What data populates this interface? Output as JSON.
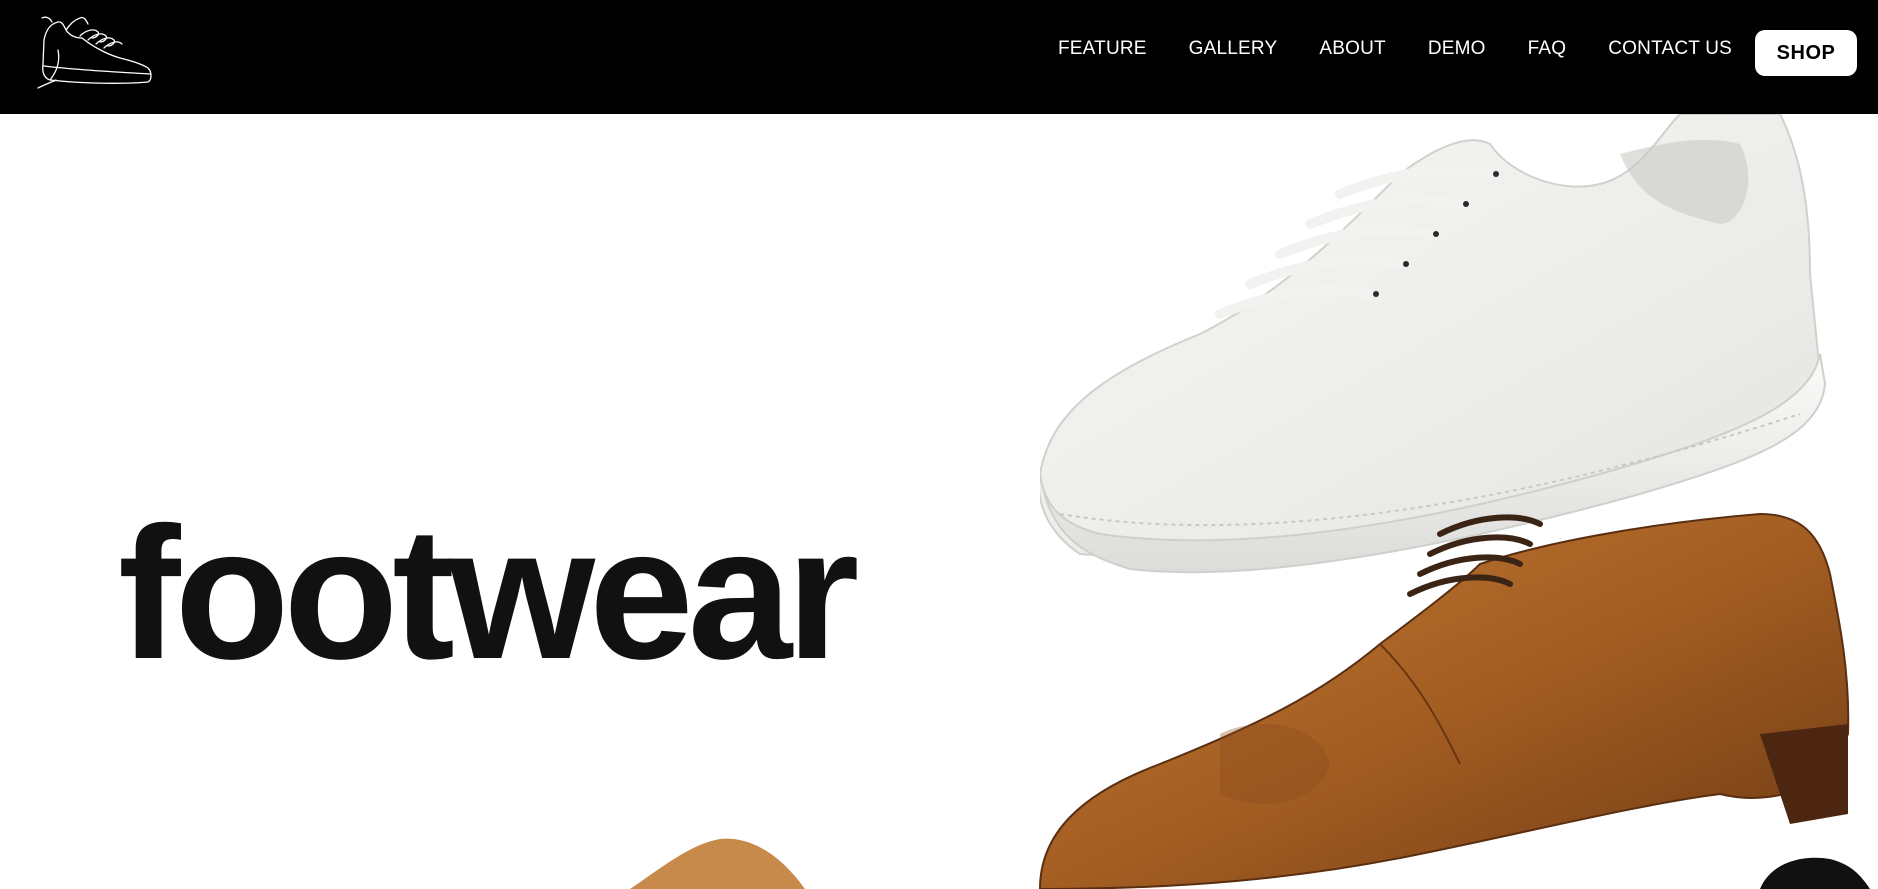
{
  "navbar": {
    "logo_icon": "sneaker-outline-logo-icon",
    "links": [
      {
        "label": "FEATURE"
      },
      {
        "label": "GALLERY"
      },
      {
        "label": "ABOUT"
      },
      {
        "label": "DEMO"
      },
      {
        "label": "FAQ"
      },
      {
        "label": "CONTACT US"
      }
    ],
    "shop_label": "SHOP"
  },
  "hero": {
    "title": "footwear",
    "images": [
      {
        "name": "white-sneaker-image",
        "description_icon": "white-leather-sneaker"
      },
      {
        "name": "brown-oxford-image",
        "description_icon": "brown-leather-oxford-shoe"
      },
      {
        "name": "tan-suede-shoe-image",
        "description_icon": "partial-tan-shoe"
      },
      {
        "name": "dark-shoe-image",
        "description_icon": "partial-dark-shoe"
      }
    ]
  },
  "colors": {
    "navbar_bg": "#000000",
    "nav_text": "#ffffff",
    "hero_bg": "#ffffff",
    "title_text": "#111111",
    "shop_button_bg": "#ffffff"
  }
}
